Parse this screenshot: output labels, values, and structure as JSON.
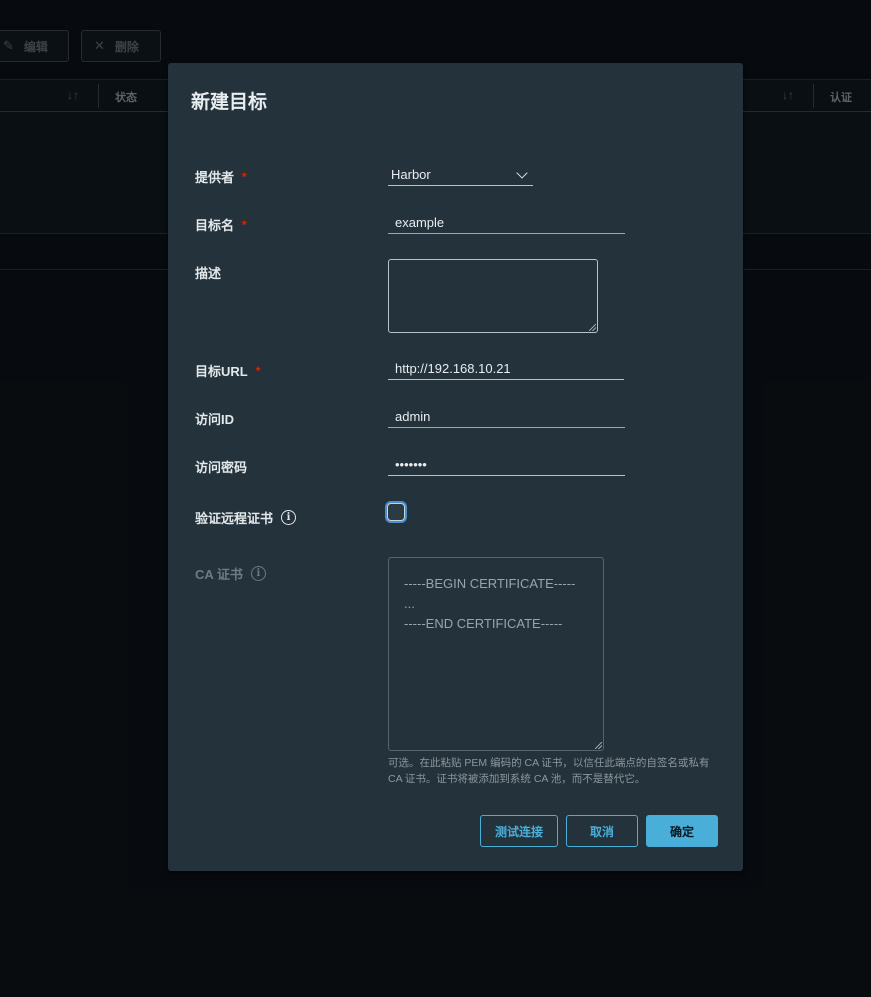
{
  "background": {
    "toolbar": {
      "edit_label": "编辑",
      "delete_label": "删除"
    },
    "table": {
      "col_status": "状态",
      "col_auth": "认证",
      "sort_glyph": "↓↑"
    }
  },
  "modal": {
    "title": "新建目标",
    "provider": {
      "label": "提供者",
      "required": "*",
      "value": "Harbor"
    },
    "target_name": {
      "label": "目标名",
      "required": "*",
      "value": "example"
    },
    "description": {
      "label": "描述",
      "value": ""
    },
    "target_url": {
      "label": "目标URL",
      "required": "*",
      "value": "http://192.168.10.21"
    },
    "access_id": {
      "label": "访问ID",
      "value": "admin"
    },
    "access_secret": {
      "label": "访问密码",
      "value": "•••••••"
    },
    "verify_cert": {
      "label": "验证远程证书"
    },
    "ca_cert": {
      "label": "CA 证书",
      "placeholder_lines": [
        "-----BEGIN CERTIFICATE-----",
        "...",
        "-----END CERTIFICATE-----"
      ],
      "help": "可选。在此粘贴 PEM 编码的 CA 证书，以信任此端点的自签名或私有 CA 证书。证书将被添加到系统 CA 池，而不是替代它。"
    },
    "buttons": {
      "test": "测试连接",
      "cancel": "取消",
      "ok": "确定"
    }
  },
  "colors": {
    "accent": "#49afd9",
    "valid": "#8cc44a",
    "required": "#e12200",
    "modal_bg": "#23323b"
  }
}
